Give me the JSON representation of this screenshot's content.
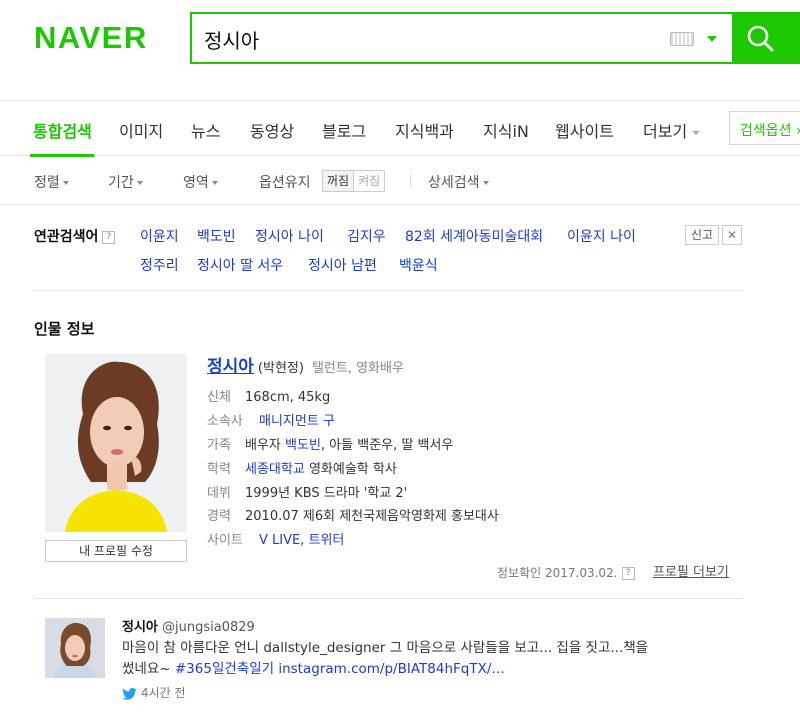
{
  "header": {
    "logo": "NAVER",
    "search_value": "정시아"
  },
  "tabs": [
    {
      "label": "통합검색",
      "active": true
    },
    {
      "label": "이미지"
    },
    {
      "label": "뉴스"
    },
    {
      "label": "동영상"
    },
    {
      "label": "블로그"
    },
    {
      "label": "지식백과"
    },
    {
      "label": "지식iN"
    },
    {
      "label": "웹사이트"
    },
    {
      "label": "더보기"
    }
  ],
  "search_options_button": "검색옵션",
  "filters": {
    "sort": "정렬",
    "period": "기간",
    "area": "영역",
    "keep_option": "옵션유지",
    "toggle_on": "꺼짐",
    "toggle_off": "켜짐",
    "detail": "상세검색"
  },
  "related": {
    "label": "연관검색어",
    "help": "?",
    "report": "신고",
    "close": "✕",
    "items": [
      "이윤지",
      "백도빈",
      "정시아 나이",
      "김지우",
      "82회 세계아동미술대회",
      "이윤지 나이",
      "정주리",
      "정시아 딸 서우",
      "정시아 남편",
      "백윤식"
    ]
  },
  "person": {
    "section_title": "인물 정보",
    "name": "정시아",
    "real_name": "(박현정)",
    "job": "탤런트, 영화배우",
    "edit_button": "내 프로필 수정",
    "body_key": "신체",
    "body_val": "168cm, 45kg",
    "agency_key": "소속사",
    "agency_val": "매니지먼트 구",
    "family_key": "가족",
    "family_pre": "배우자",
    "family_spouse": "백도빈",
    "family_rest": ", 아들 백준우, 딸 백서우",
    "edu_key": "학력",
    "edu_link": "세종대학교",
    "edu_rest": "영화예술학 학사",
    "debut_key": "데뷔",
    "debut_val": "1999년 KBS 드라마 '학교 2'",
    "career_key": "경력",
    "career_val": "2010.07 제6회 제천국제음악영화제 홍보대사",
    "site_key": "사이트",
    "site_vlive": "V LIVE",
    "site_sep": ",",
    "site_twitter": "트위터",
    "verified": "정보확인 2017.03.02.",
    "verified_help": "?",
    "more_profile": "프로필 더보기"
  },
  "tweet": {
    "name": "정시아",
    "handle": "@jungsia0829",
    "text_line1": "마음이 참 아름다운 언니 dallstyle_designer 그 마음으로 사람들을 보고... 집을 짓고...책을",
    "text_line2_pre": "썼네요~",
    "text_link": "#365일건축일기 instagram.com/p/BIAT84hFqTX/…",
    "time": "4시간 전"
  },
  "colors": {
    "brand_green": "#1ec800",
    "link_blue": "#1a3ecc",
    "twitter_blue": "#1da1f2"
  }
}
